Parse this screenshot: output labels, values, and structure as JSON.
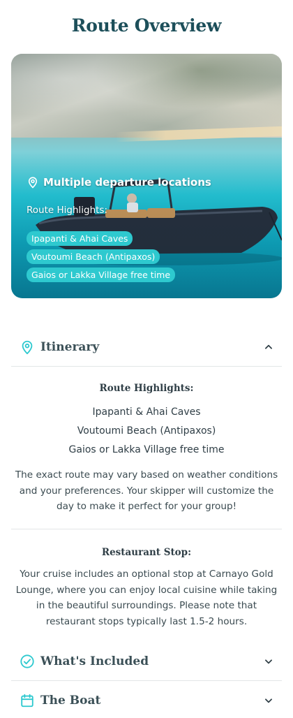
{
  "page": {
    "title": "Route Overview"
  },
  "hero": {
    "location_text": "Multiple departure locations",
    "highlights_title": "Route Highlights:",
    "chips": [
      "Ipapanti & Ahai Caves",
      "Voutoumi Beach (Antipaxos)",
      "Gaios or Lakka Village free time"
    ]
  },
  "itinerary": {
    "title": "Itinerary",
    "icon": "map-pin-icon",
    "expanded": true,
    "highlights_title": "Route Highlights:",
    "highlights": [
      "Ipapanti & Ahai Caves",
      "Voutoumi Beach (Antipaxos)",
      "Gaios or Lakka Village free time"
    ],
    "note": "The exact route may vary based on weather conditions and your preferences. Your skipper will customize the day to make it perfect for your group!",
    "restaurant_title": "Restaurant Stop:",
    "restaurant_text": "Your cruise includes an optional stop at Carnayo Gold Lounge, where you can enjoy local cuisine while taking in the beautiful surroundings. Please note that restaurant stops typically last 1.5-2 hours."
  },
  "included": {
    "title": "What's Included",
    "icon": "check-circle-icon",
    "expanded": false
  },
  "boat": {
    "title": "The Boat",
    "icon": "calendar-icon",
    "expanded": false
  },
  "colors": {
    "accent": "#2ec9cf",
    "heading": "#1d4f5a",
    "text": "#2f3e46"
  }
}
